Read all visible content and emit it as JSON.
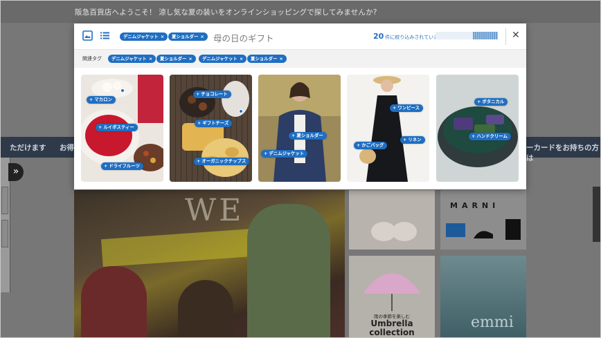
{
  "page": {
    "welcome_text": "阪急百貨店へようこそ！ 涼し気な夏の装いをオンラインショッピングで探してみませんか?",
    "banner_left": "ただけます",
    "banner_left2": "お得",
    "banner_right": "ーカードをお持ちの方は",
    "side_toggle": "»"
  },
  "background_tiles": {
    "hero_title": "WE",
    "marni": "MARNI",
    "umbrella_line1": "雨の季節を楽しむ",
    "umbrella_line2": "Umbrella",
    "umbrella_line3": "collection",
    "emmi": "emmi"
  },
  "modal": {
    "header_chips": [
      {
        "label": "デニムジャケット"
      },
      {
        "label": "夏ショルダー"
      }
    ],
    "search_query": "母の日のギフト",
    "count_number": "20",
    "count_suffix": "件に絞り込みされています",
    "progress_fraction": 0.4,
    "close_glyph": "✕",
    "chip_remove_glyph": "×",
    "related_label": "関連タグ",
    "related_tags": [
      {
        "label": "デニムジャケット"
      },
      {
        "label": "夏ショルダー"
      },
      {
        "label": "デニムジャケット"
      },
      {
        "label": "夏ショルダー"
      }
    ],
    "cards": [
      {
        "tags": [
          "マカロン",
          "ルイボスティー",
          "ドライフルーツ"
        ]
      },
      {
        "tags": [
          "チョコレート",
          "ギフトチーズ",
          "オーガニックチップス"
        ]
      },
      {
        "tags": [
          "夏ショルダー",
          "デニムジャケット"
        ]
      },
      {
        "tags": [
          "ワンピース",
          "かごバッグ",
          "リネン"
        ]
      },
      {
        "tags": [
          "ボタニカル",
          "ハンドクリーム"
        ]
      }
    ]
  },
  "colors": {
    "accent": "#1f6ec2",
    "overlay": "#777777"
  }
}
